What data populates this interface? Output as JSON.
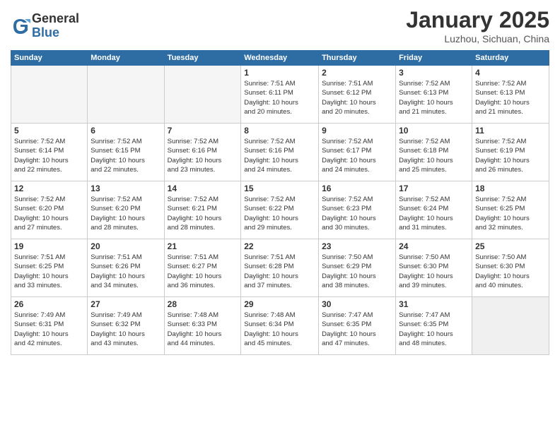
{
  "logo": {
    "general": "General",
    "blue": "Blue"
  },
  "header": {
    "month": "January 2025",
    "location": "Luzhou, Sichuan, China"
  },
  "weekdays": [
    "Sunday",
    "Monday",
    "Tuesday",
    "Wednesday",
    "Thursday",
    "Friday",
    "Saturday"
  ],
  "weeks": [
    [
      {
        "day": "",
        "info": ""
      },
      {
        "day": "",
        "info": ""
      },
      {
        "day": "",
        "info": ""
      },
      {
        "day": "1",
        "info": "Sunrise: 7:51 AM\nSunset: 6:11 PM\nDaylight: 10 hours\nand 20 minutes."
      },
      {
        "day": "2",
        "info": "Sunrise: 7:51 AM\nSunset: 6:12 PM\nDaylight: 10 hours\nand 20 minutes."
      },
      {
        "day": "3",
        "info": "Sunrise: 7:52 AM\nSunset: 6:13 PM\nDaylight: 10 hours\nand 21 minutes."
      },
      {
        "day": "4",
        "info": "Sunrise: 7:52 AM\nSunset: 6:13 PM\nDaylight: 10 hours\nand 21 minutes."
      }
    ],
    [
      {
        "day": "5",
        "info": "Sunrise: 7:52 AM\nSunset: 6:14 PM\nDaylight: 10 hours\nand 22 minutes."
      },
      {
        "day": "6",
        "info": "Sunrise: 7:52 AM\nSunset: 6:15 PM\nDaylight: 10 hours\nand 22 minutes."
      },
      {
        "day": "7",
        "info": "Sunrise: 7:52 AM\nSunset: 6:16 PM\nDaylight: 10 hours\nand 23 minutes."
      },
      {
        "day": "8",
        "info": "Sunrise: 7:52 AM\nSunset: 6:16 PM\nDaylight: 10 hours\nand 24 minutes."
      },
      {
        "day": "9",
        "info": "Sunrise: 7:52 AM\nSunset: 6:17 PM\nDaylight: 10 hours\nand 24 minutes."
      },
      {
        "day": "10",
        "info": "Sunrise: 7:52 AM\nSunset: 6:18 PM\nDaylight: 10 hours\nand 25 minutes."
      },
      {
        "day": "11",
        "info": "Sunrise: 7:52 AM\nSunset: 6:19 PM\nDaylight: 10 hours\nand 26 minutes."
      }
    ],
    [
      {
        "day": "12",
        "info": "Sunrise: 7:52 AM\nSunset: 6:20 PM\nDaylight: 10 hours\nand 27 minutes."
      },
      {
        "day": "13",
        "info": "Sunrise: 7:52 AM\nSunset: 6:20 PM\nDaylight: 10 hours\nand 28 minutes."
      },
      {
        "day": "14",
        "info": "Sunrise: 7:52 AM\nSunset: 6:21 PM\nDaylight: 10 hours\nand 28 minutes."
      },
      {
        "day": "15",
        "info": "Sunrise: 7:52 AM\nSunset: 6:22 PM\nDaylight: 10 hours\nand 29 minutes."
      },
      {
        "day": "16",
        "info": "Sunrise: 7:52 AM\nSunset: 6:23 PM\nDaylight: 10 hours\nand 30 minutes."
      },
      {
        "day": "17",
        "info": "Sunrise: 7:52 AM\nSunset: 6:24 PM\nDaylight: 10 hours\nand 31 minutes."
      },
      {
        "day": "18",
        "info": "Sunrise: 7:52 AM\nSunset: 6:25 PM\nDaylight: 10 hours\nand 32 minutes."
      }
    ],
    [
      {
        "day": "19",
        "info": "Sunrise: 7:51 AM\nSunset: 6:25 PM\nDaylight: 10 hours\nand 33 minutes."
      },
      {
        "day": "20",
        "info": "Sunrise: 7:51 AM\nSunset: 6:26 PM\nDaylight: 10 hours\nand 34 minutes."
      },
      {
        "day": "21",
        "info": "Sunrise: 7:51 AM\nSunset: 6:27 PM\nDaylight: 10 hours\nand 36 minutes."
      },
      {
        "day": "22",
        "info": "Sunrise: 7:51 AM\nSunset: 6:28 PM\nDaylight: 10 hours\nand 37 minutes."
      },
      {
        "day": "23",
        "info": "Sunrise: 7:50 AM\nSunset: 6:29 PM\nDaylight: 10 hours\nand 38 minutes."
      },
      {
        "day": "24",
        "info": "Sunrise: 7:50 AM\nSunset: 6:30 PM\nDaylight: 10 hours\nand 39 minutes."
      },
      {
        "day": "25",
        "info": "Sunrise: 7:50 AM\nSunset: 6:30 PM\nDaylight: 10 hours\nand 40 minutes."
      }
    ],
    [
      {
        "day": "26",
        "info": "Sunrise: 7:49 AM\nSunset: 6:31 PM\nDaylight: 10 hours\nand 42 minutes."
      },
      {
        "day": "27",
        "info": "Sunrise: 7:49 AM\nSunset: 6:32 PM\nDaylight: 10 hours\nand 43 minutes."
      },
      {
        "day": "28",
        "info": "Sunrise: 7:48 AM\nSunset: 6:33 PM\nDaylight: 10 hours\nand 44 minutes."
      },
      {
        "day": "29",
        "info": "Sunrise: 7:48 AM\nSunset: 6:34 PM\nDaylight: 10 hours\nand 45 minutes."
      },
      {
        "day": "30",
        "info": "Sunrise: 7:47 AM\nSunset: 6:35 PM\nDaylight: 10 hours\nand 47 minutes."
      },
      {
        "day": "31",
        "info": "Sunrise: 7:47 AM\nSunset: 6:35 PM\nDaylight: 10 hours\nand 48 minutes."
      },
      {
        "day": "",
        "info": ""
      }
    ]
  ]
}
